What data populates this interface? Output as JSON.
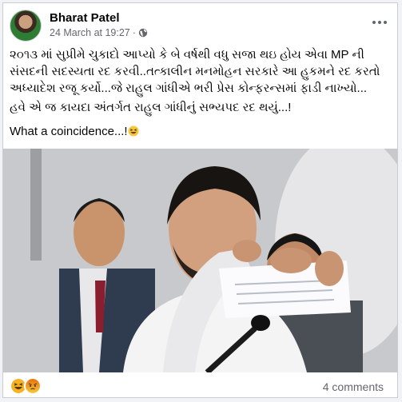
{
  "post": {
    "author": "Bharat Patel",
    "date": "24 March at 19:27",
    "separator": "·",
    "audience_icon": "globe-icon",
    "more_icon": "more-options-icon",
    "text_line_1": "૨૦૧૩ માં સુપ્રીમે ચુકાદો આપ્યો કે બે વર્ષથી વધુ સજા થઇ હોય એવા MP ની સંસદની સદસ્યતા રદ કરવી..તત્કાલીન મનમોહન સરકારે આ હુકમને રદ કરતો અધ્યાદેશ રજૂ કર્યો...જે રાહુલ ગાંધીએ ભરી પ્રેસ કોન્ફરન્સમાં ફાડી નાખ્યો...",
    "text_line_2": "હવે એ જ કાયદા અંતર્ગત રાહુલ ગાંધીનું સભ્યપદ રદ થયું...!",
    "text_line_3": "What a coincidence...!",
    "text_line_3_emoji": "grinning-squinting-face-icon"
  },
  "footer": {
    "reactions": [
      "haha-reaction-icon",
      "angry-reaction-icon"
    ],
    "comments": "4 comments"
  },
  "colors": {
    "name": "#050505",
    "meta": "#65676b",
    "haha": "#f7b125",
    "angry": "#e9710f"
  }
}
